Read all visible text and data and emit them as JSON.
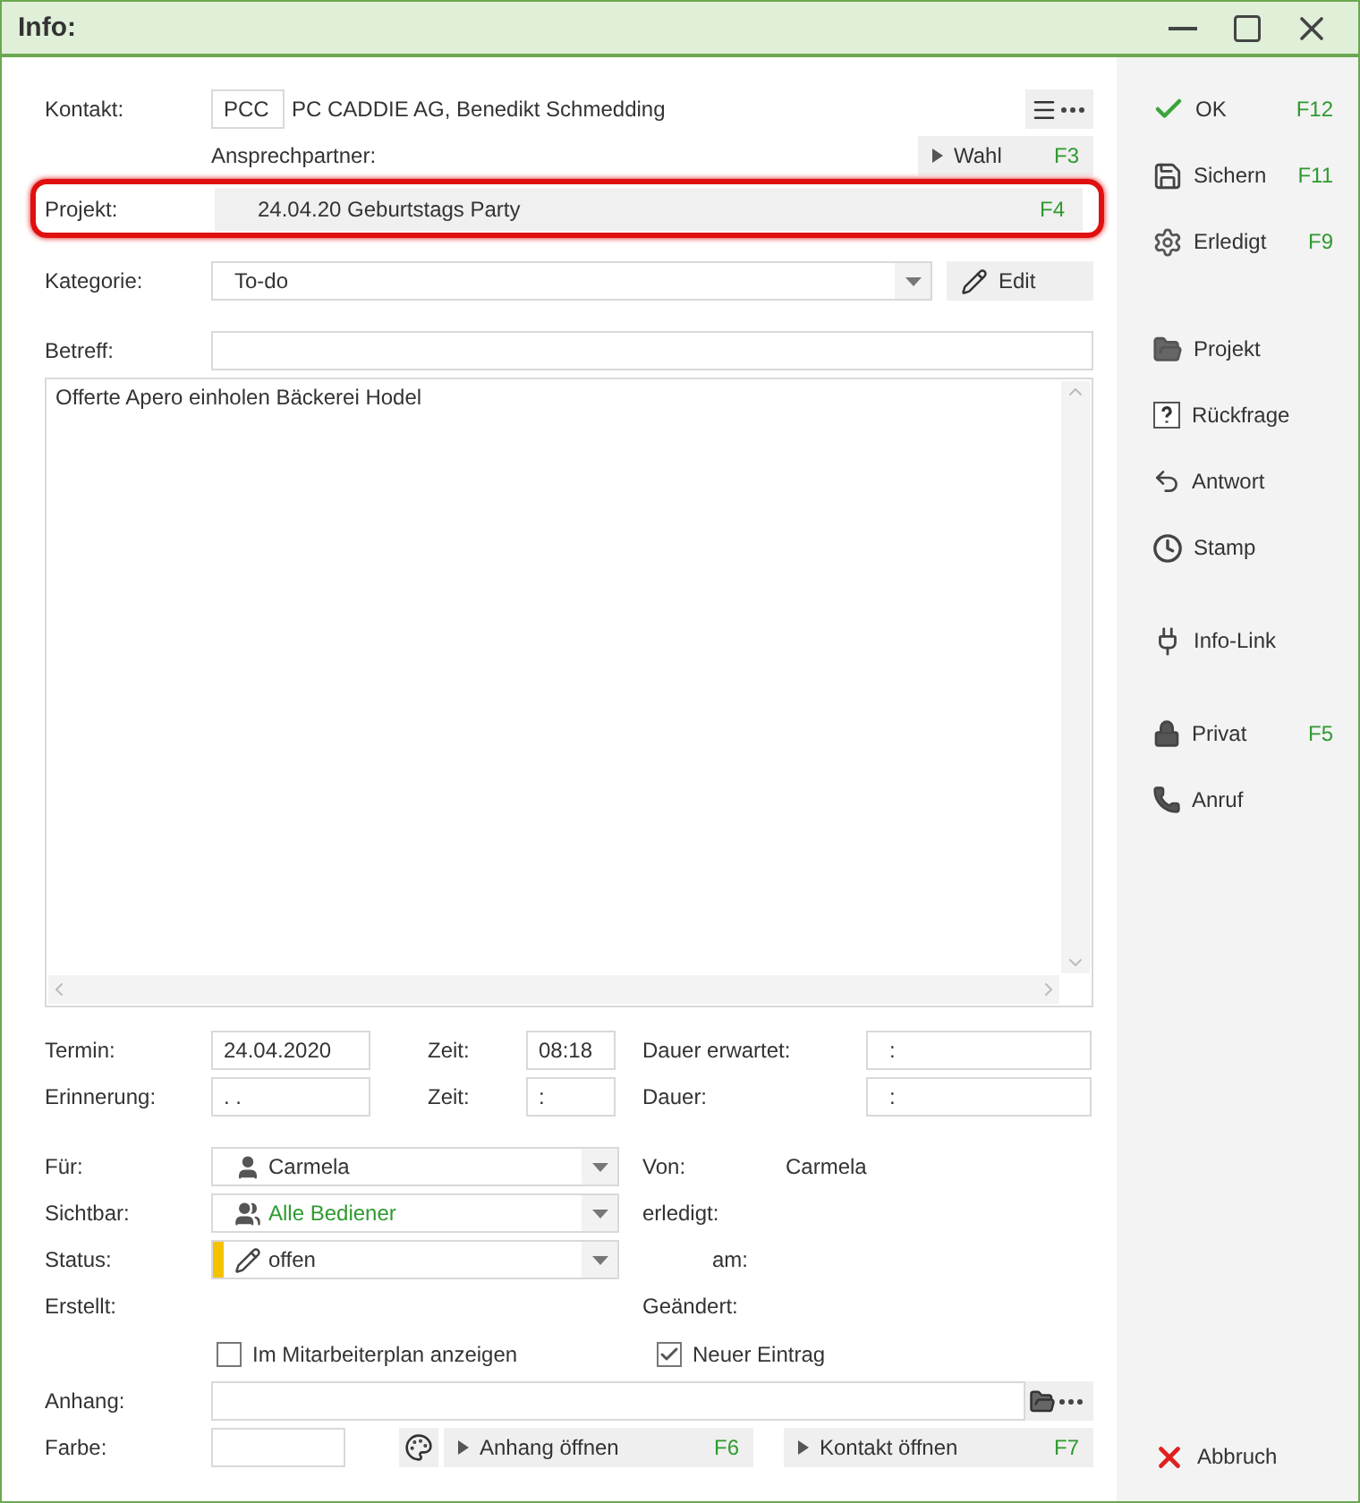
{
  "window": {
    "title": "Info:"
  },
  "contact": {
    "label": "Kontakt:",
    "code": "PCC",
    "name": "PC CADDIE AG, Benedikt Schmedding"
  },
  "contact_person": {
    "label": "Ansprechpartner:",
    "button": {
      "label": "Wahl",
      "key": "F3"
    }
  },
  "project": {
    "label": "Projekt:",
    "value": "24.04.20 Geburtstags Party",
    "key": "F4",
    "highlighted": true
  },
  "category": {
    "label": "Kategorie:",
    "value": "To-do",
    "edit_button": "Edit"
  },
  "subject": {
    "label": "Betreff:"
  },
  "body": "Offerte Apero einholen Bäckerei Hodel",
  "schedule": [
    {
      "label": "Termin:",
      "date": "24.04.2020",
      "time_label": "Zeit:",
      "time": "08:18",
      "duration_label": "Dauer erwartet:",
      "duration": ":"
    },
    {
      "label": "Erinnerung:",
      "date": ". .",
      "time_label": "Zeit:",
      "time": ":",
      "duration_label": "Dauer:",
      "duration": ":"
    }
  ],
  "assignments": [
    {
      "kind": "person",
      "label": "Für:",
      "value": "Carmela",
      "side_label": "Von:",
      "side_value": "Carmela"
    },
    {
      "kind": "group",
      "label": "Sichtbar:",
      "value": "Alle Bediener",
      "side_label": "erledigt:"
    },
    {
      "kind": "status",
      "label": "Status:",
      "value": "offen",
      "color": "#f5c200",
      "side_label": "am:"
    },
    {
      "kind": "plain",
      "label": "Erstellt:",
      "side_label": "Geändert:"
    }
  ],
  "checkboxes": [
    {
      "label": "Im Mitarbeiterplan anzeigen",
      "checked": false
    },
    {
      "label": "Neuer Eintrag",
      "checked": true
    }
  ],
  "attachment": {
    "label": "Anhang:"
  },
  "color_field": {
    "label": "Farbe:"
  },
  "bottom_buttons": [
    {
      "label": "Anhang öffnen",
      "key": "F6"
    },
    {
      "label": "Kontakt öffnen",
      "key": "F7"
    }
  ],
  "sidebar": {
    "groups": [
      [
        {
          "label": "OK",
          "key": "F12"
        },
        {
          "label": "Sichern",
          "key": "F11"
        },
        {
          "label": "Erledigt",
          "key": "F9"
        }
      ],
      [
        {
          "label": "Projekt"
        },
        {
          "label": "Rückfrage"
        },
        {
          "label": "Antwort"
        },
        {
          "label": "Stamp"
        }
      ],
      [
        {
          "label": "Info-Link"
        }
      ],
      [
        {
          "label": "Privat",
          "key": "F5"
        },
        {
          "label": "Anruf"
        }
      ]
    ],
    "cancel": {
      "label": "Abbruch"
    }
  }
}
